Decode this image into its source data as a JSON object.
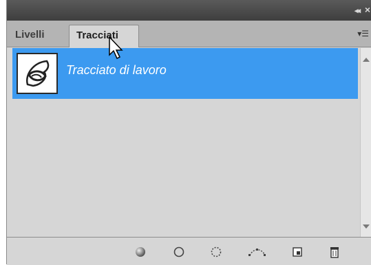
{
  "window": {
    "collapse_icon": "double-chevron-icon",
    "close_icon": "close-icon"
  },
  "tabs": [
    {
      "label": "Livelli",
      "active": false
    },
    {
      "label": "Tracciati",
      "active": true
    }
  ],
  "panel_menu_icon": "panel-menu-icon",
  "paths": [
    {
      "name": "Tracciato di lavoro",
      "selected": true,
      "thumbnail_icon": "path-thumbnail"
    }
  ],
  "selection_color": "#3c9af0",
  "bottom_toolbar": [
    "fill-path-icon",
    "stroke-path-icon",
    "load-path-as-selection-icon",
    "make-work-path-from-selection-icon",
    "create-new-path-icon",
    "delete-path-icon"
  ]
}
